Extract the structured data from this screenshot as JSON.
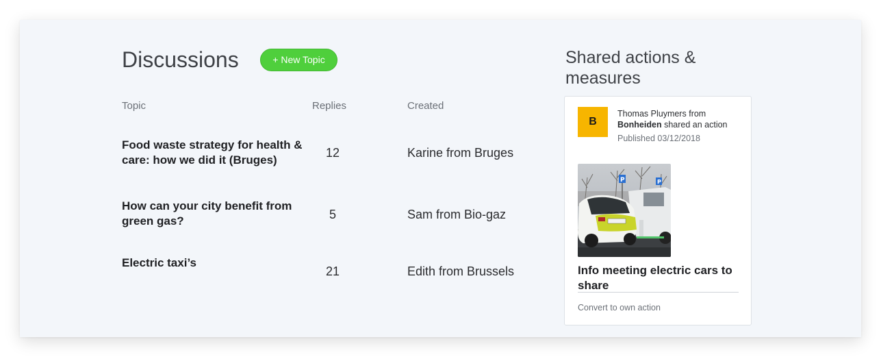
{
  "discussions": {
    "title": "Discussions",
    "new_topic_label": "+ New Topic",
    "columns": {
      "topic": "Topic",
      "replies": "Replies",
      "created": "Created"
    },
    "rows": [
      {
        "topic": "Food waste strategy for health & care: how we did it (Bruges)",
        "replies": "12",
        "created": "Karine from Bruges"
      },
      {
        "topic": "How can your city benefit from green gas?",
        "replies": "5",
        "created": "Sam from Bio-gaz"
      },
      {
        "topic": "Electric taxi’s",
        "replies": "21",
        "created": "Edith from Brussels"
      }
    ]
  },
  "shared": {
    "title": "Shared actions & measures",
    "card": {
      "avatar_letter": "B",
      "author": "Thomas Pluymers",
      "from_word": "from",
      "org": "Bonheiden",
      "shared_text": "shared an action",
      "published": "Published 03/12/2018",
      "action_title": "Info meeting electric cars to share",
      "convert_label": "Convert to own action"
    }
  },
  "colors": {
    "accent_green": "#4fcf3c",
    "avatar_yellow": "#f7b500",
    "panel_bg": "#f3f6fa"
  }
}
